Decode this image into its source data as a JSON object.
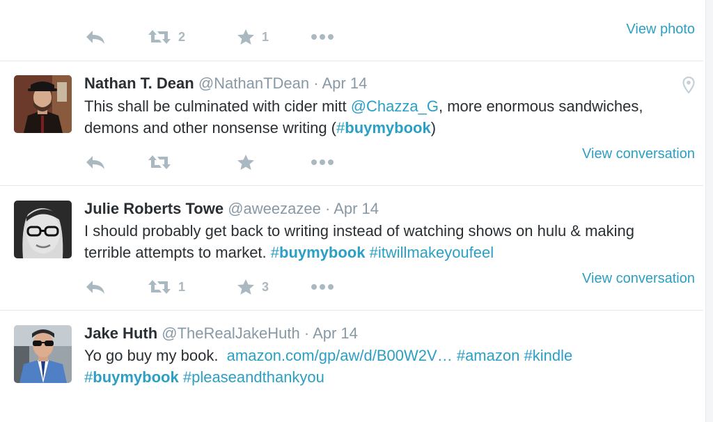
{
  "top_tweet": {
    "retweets": "2",
    "favorites": "1",
    "view_link": "View photo"
  },
  "tweets": [
    {
      "name": "Nathan T. Dean",
      "handle": "@NathanTDean",
      "dot": "·",
      "date": "Apr 14",
      "text_1": "This shall be culminated with cider mitt ",
      "mention": "@Chazza_G",
      "text_2": ", more enormous sandwiches, demons and other nonsense writing (",
      "hashtag_1_hash": "#",
      "hashtag_1_word": "buymybook",
      "text_3": ")",
      "retweets": "",
      "favorites": "",
      "view_link": "View conversation",
      "has_location": true
    },
    {
      "name": "Julie Roberts Towe",
      "handle": "@aweezazee",
      "dot": "·",
      "date": "Apr 14",
      "text_1": "I should probably get back to writing instead of watching shows on hulu & making terrible attempts to market. ",
      "hashtag_1_hash": "#",
      "hashtag_1_word": "buymybook",
      "hashtag_2": "#itwillmakeyoufeel",
      "retweets": "1",
      "favorites": "3",
      "view_link": "View conversation"
    },
    {
      "name": "Jake Huth",
      "handle": "@TheRealJakeHuth",
      "dot": "·",
      "date": "Apr 14",
      "text_1": "Yo go buy my book.  ",
      "url": "amazon.com/gp/aw/d/B00W2V…",
      "hashtag_2": "#amazon",
      "hashtag_3": "#kindle",
      "hashtag_1_hash": "#",
      "hashtag_1_word": "buymybook",
      "hashtag_4": "#pleaseandthankyou"
    }
  ],
  "icons": {
    "reply": "reply-icon",
    "retweet": "retweet-icon",
    "favorite": "star-icon",
    "more": "more-icon",
    "location": "location-pin-icon"
  },
  "colors": {
    "link": "#2b9fc4",
    "icon": "#aab8c2",
    "meta": "#8899a6",
    "text": "#292f33",
    "separator": "#e1e8ed"
  }
}
